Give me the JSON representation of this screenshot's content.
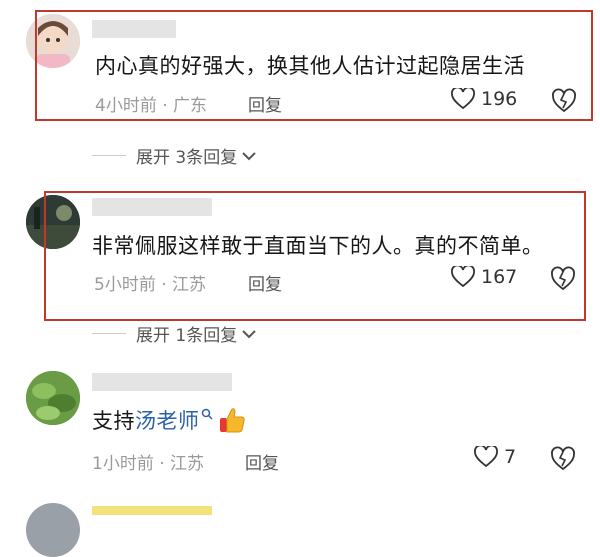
{
  "comments": [
    {
      "text": "内心真的好强大，换其他人估计过起隐居生活",
      "time_location": "4小时前 · 广东",
      "reply_label": "回复",
      "likes": "196",
      "expand_label": "展开 3条回复"
    },
    {
      "text": "非常佩服这样敢于直面当下的人。真的不简单。",
      "time_location": "5小时前 · 江苏",
      "reply_label": "回复",
      "likes": "167",
      "expand_label": "展开 1条回复"
    },
    {
      "text_prefix": "支持",
      "text_link": "汤老师",
      "time_location": "1小时前 · 江苏",
      "reply_label": "回复",
      "likes": "7"
    }
  ],
  "colors": {
    "highlight": "#c0392b",
    "link": "#2a61a8",
    "meta": "#9a9a9a"
  },
  "icons": [
    "heart-icon",
    "dislike-heart-icon",
    "chevron-down-icon",
    "search-tag-icon",
    "thumbs-up-emoji"
  ]
}
